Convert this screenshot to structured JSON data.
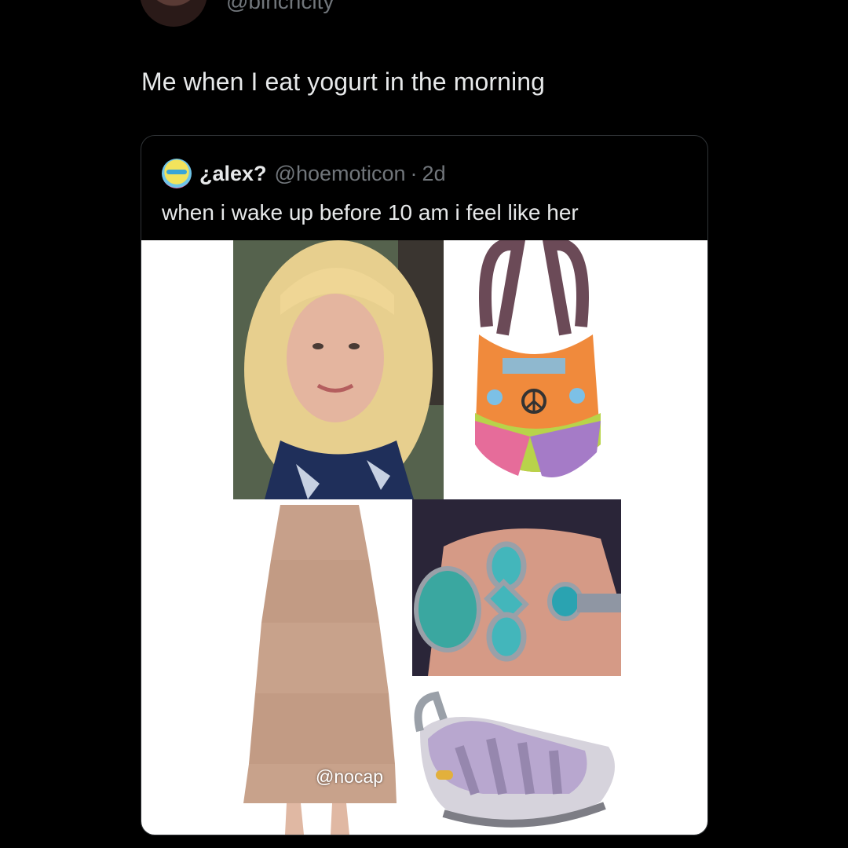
{
  "author": {
    "handle": "@binchcity"
  },
  "tweet": {
    "text": "Me when I eat yogurt in the morning"
  },
  "quoted": {
    "name": "¿alex?",
    "handle": "@hoemoticon",
    "separator": "·",
    "time": "2d",
    "text": "when i wake up before 10 am i feel like her"
  },
  "media": {
    "watermark": "@nocap",
    "tiles": [
      "woman-portrait",
      "patchwork-bag",
      "turquoise-rings",
      "tiered-skirt",
      "lavender-sandal"
    ]
  },
  "colors": {
    "background": "#000000",
    "text": "#e7e9ea",
    "muted": "#71767b",
    "border": "#2f3336"
  }
}
